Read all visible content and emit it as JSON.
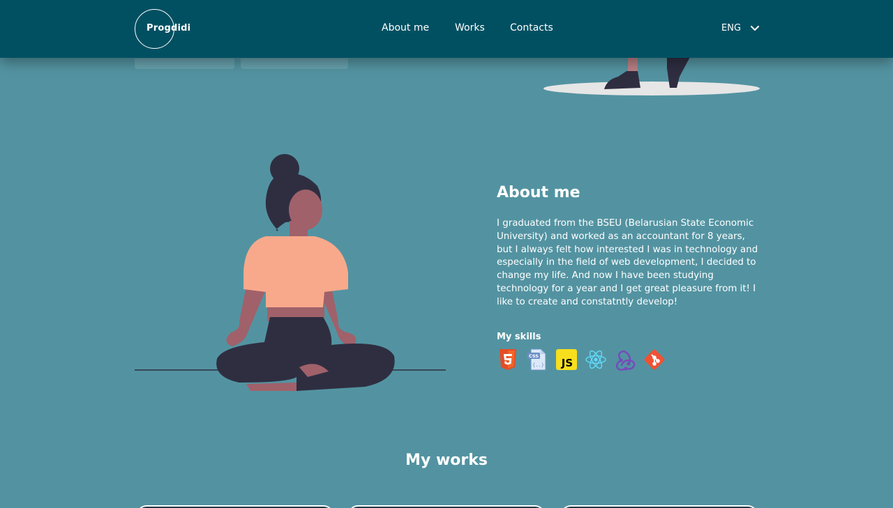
{
  "header": {
    "logo_text": "Progdidi",
    "nav": [
      {
        "label": "About me"
      },
      {
        "label": "Works"
      },
      {
        "label": "Contacts"
      }
    ],
    "language": "ENG"
  },
  "about": {
    "title": "About me",
    "text": "I graduated from the BSEU (Belarusian State Economic University) and worked as an accountant for 8 years, but I always felt how interested I was in technology and especially in the field of web development, I decided to change my life. And now I have been studying technology for a year and I get great pleasure from it! I like to create and constatntly develop!",
    "skills_title": "My skills",
    "skills": [
      "html5-icon",
      "css-icon",
      "javascript-icon",
      "react-icon",
      "redux-icon",
      "git-icon"
    ]
  },
  "works": {
    "title": "My works"
  },
  "colors": {
    "header_bg": "#015062",
    "page_bg": "#5393a1",
    "text": "#ffffff"
  }
}
